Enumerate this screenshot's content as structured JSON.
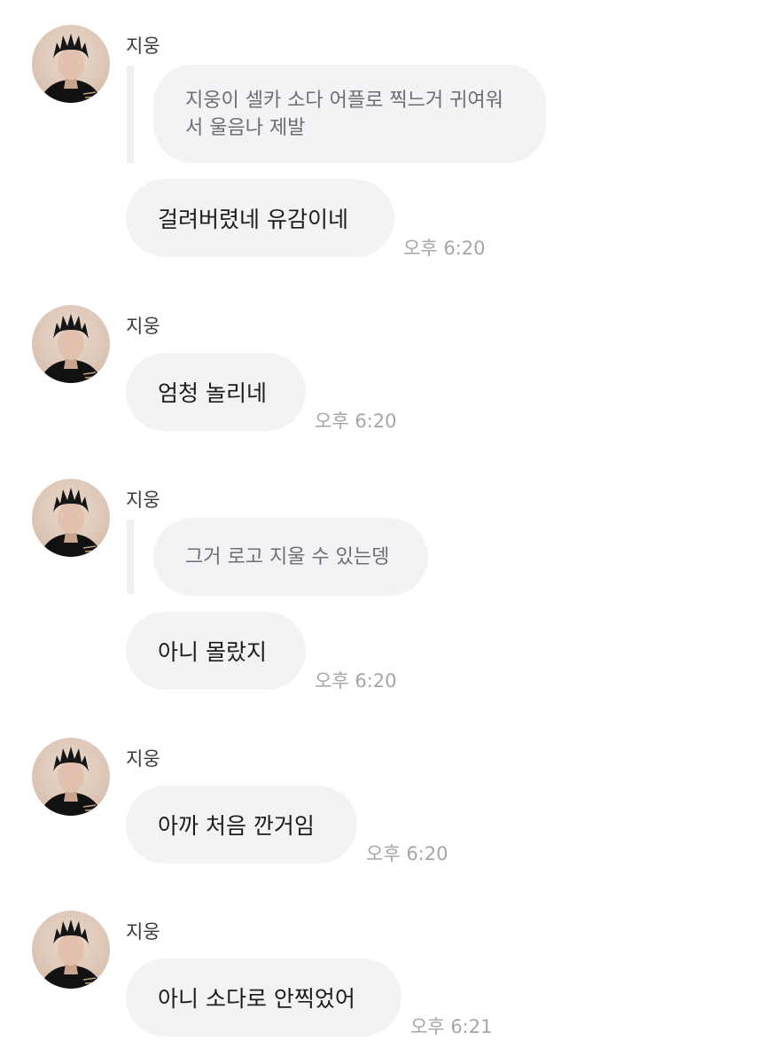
{
  "messages": [
    {
      "sender": "지웅",
      "quote": "지웅이 셀카 소다 어플로 찍느거 귀여워서 울음나 제발",
      "quote_lines": [
        "지웅이 셀카 소다 어플로 찍느거 귀여워",
        "서 울음나 제발"
      ],
      "text": "걸려버렸네 유감이네",
      "time": "오후 6:20"
    },
    {
      "sender": "지웅",
      "text": "엄청 놀리네",
      "time": "오후 6:20"
    },
    {
      "sender": "지웅",
      "quote": "그거 로고 지울 수 있는뎅",
      "text": "아니 몰랐지",
      "time": "오후 6:20"
    },
    {
      "sender": "지웅",
      "text": "아까 처음 깐거임",
      "time": "오후 6:20"
    },
    {
      "sender": "지웅",
      "text": "아니 소다로 안찍었어",
      "time": "오후 6:21"
    }
  ],
  "icons": {
    "avatar": "profile-photo"
  },
  "colors": {
    "background": "#ffffff",
    "bubble": "#f3f3f6",
    "quote_text": "#6d6d72",
    "timestamp": "#a5a5aa"
  }
}
